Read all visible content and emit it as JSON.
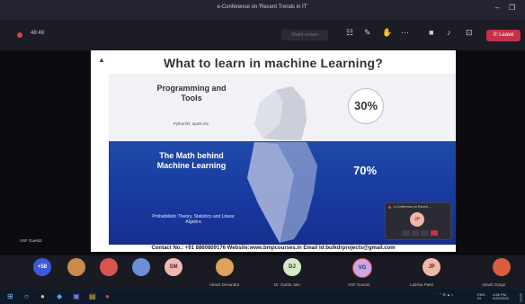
{
  "window": {
    "title": "e-Conference on 'Recent Trends in IT'",
    "minimize": "–",
    "maximize": "❐"
  },
  "toolbar": {
    "timer": "48:49",
    "shade_button": "Share screen",
    "icons": [
      "people-icon",
      "chat-icon",
      "hand-icon",
      "more-icon",
      "camera-icon",
      "mic-icon",
      "share-icon"
    ],
    "leave_label": "Leave"
  },
  "slide": {
    "title": "What to learn in machine Learning?",
    "prog": {
      "heading": "Programming and Tools",
      "sub": "Python/R, spark etc.",
      "percent": "30%"
    },
    "math": {
      "heading": "The Math behind Machine Learning",
      "sub": "Probabilistic Theory, Statistics and Linear Algebra",
      "percent": "70%"
    },
    "contact": "Contact No.: +91 8860809176 Website:www.bmpcourses.in Email Id:bulkdrprojects@gmail.com"
  },
  "mini_window": {
    "title": "e-Conference on Recent ...",
    "avatar": "JP"
  },
  "presenter_label": "VSF Guest2",
  "participants": [
    {
      "initials": "+58",
      "color": "#3b5bdb",
      "name": ""
    },
    {
      "initials": "",
      "color": "#c88c4b",
      "name": ""
    },
    {
      "initials": "",
      "color": "#d9544f",
      "name": ""
    },
    {
      "initials": "",
      "color": "#6a8fd6",
      "name": ""
    },
    {
      "initials": "SM",
      "color": "#f2b8b0",
      "name": ""
    },
    {
      "initials": "",
      "color": "#e0a25a",
      "name": "Akash Devandra"
    },
    {
      "initials": "DJ",
      "color": "#d6e8c8",
      "name": "Dr. Garita Jain"
    },
    {
      "initials": "VG",
      "color": "#c9a6e6",
      "name": "VSF Guest2"
    },
    {
      "initials": "JP",
      "color": "#f3b7a5",
      "name": "Latisha Patel"
    },
    {
      "initials": "",
      "color": "#d95d3b",
      "name": "Akash Garge"
    }
  ],
  "taskbar": {
    "icons": [
      "windows-icon",
      "search-icon",
      "chrome-icon",
      "vscode-icon",
      "teams-icon",
      "explorer-icon",
      "chrome2-icon"
    ],
    "lang": "ENG",
    "region": "IN",
    "time": "4:56 PM",
    "date": "9/20/2020"
  }
}
